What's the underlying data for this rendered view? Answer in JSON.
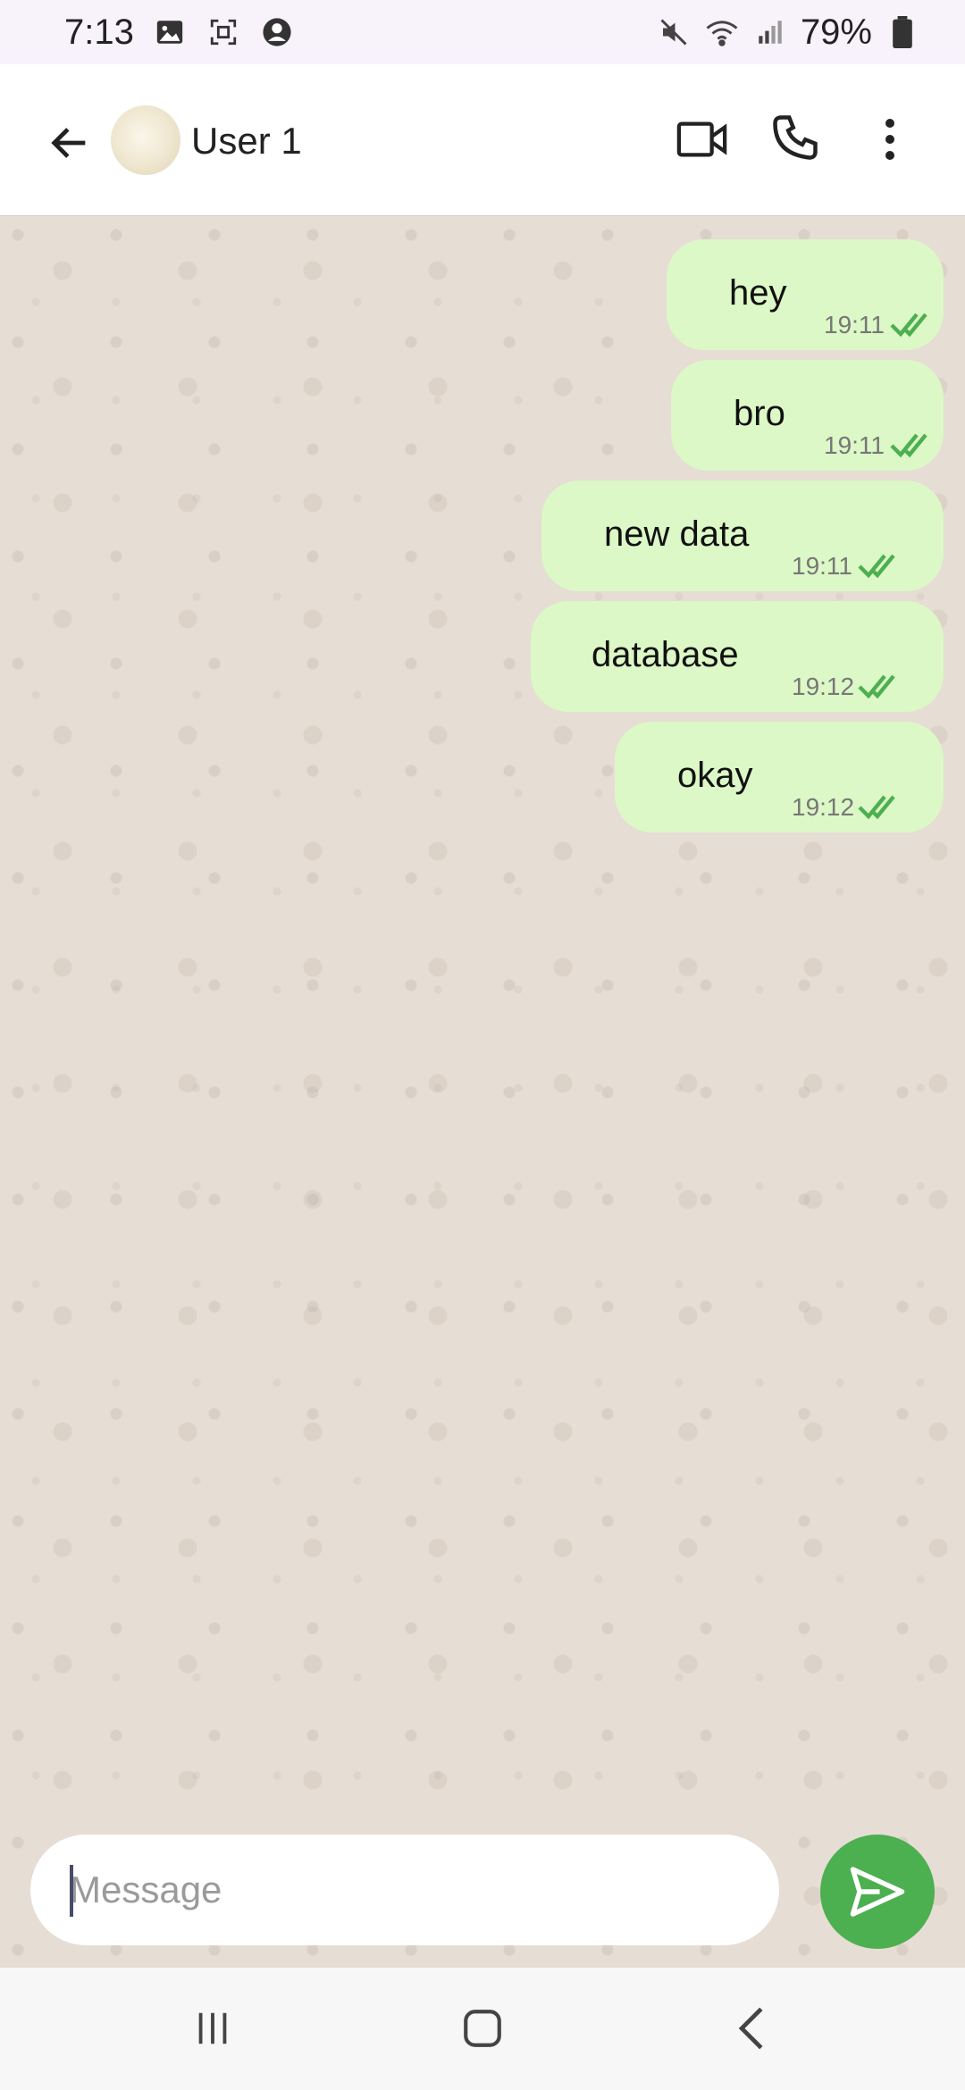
{
  "status_bar": {
    "time": "7:13",
    "battery": "79%",
    "icons": [
      "gallery-icon",
      "screenshot-icon",
      "account-icon",
      "mute-icon",
      "wifi-icon",
      "signal-icon",
      "battery-icon"
    ]
  },
  "header": {
    "contact_name": "User 1",
    "icons": [
      "back-arrow-icon",
      "video-camera-icon",
      "phone-icon",
      "more-vert-icon"
    ]
  },
  "messages": [
    {
      "text": "hey",
      "time": "19:11",
      "status": "read"
    },
    {
      "text": "bro",
      "time": "19:11",
      "status": "read"
    },
    {
      "text": "new data",
      "time": "19:11",
      "status": "read"
    },
    {
      "text": "database",
      "time": "19:12",
      "status": "read"
    },
    {
      "text": "okay",
      "time": "19:12",
      "status": "read"
    }
  ],
  "composer": {
    "placeholder": "Message",
    "value": ""
  },
  "colors": {
    "bubble_outgoing": "#dcf8c6",
    "read_ticks": "#4caf50",
    "send_button": "#4caf50",
    "chat_background": "#e6ddd4"
  }
}
